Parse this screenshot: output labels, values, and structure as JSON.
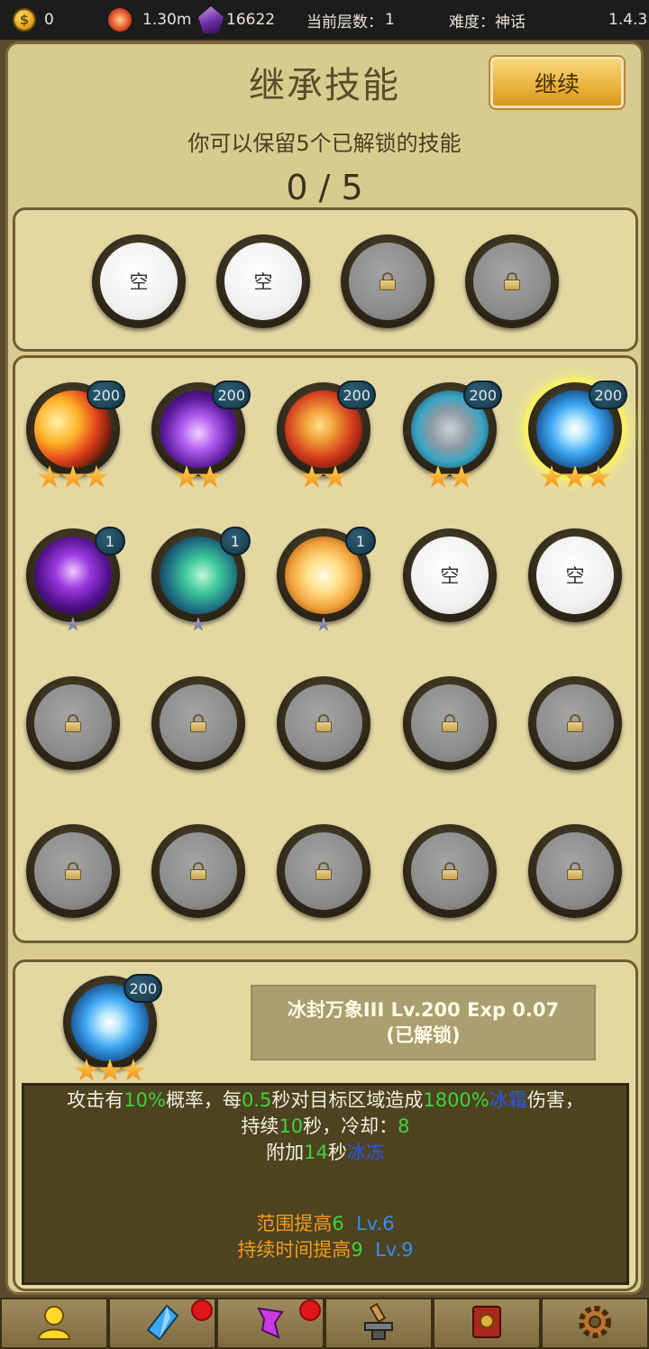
{
  "topbar": {
    "gold": "0",
    "power": "1.30m",
    "gems": "16622",
    "floor_label": "当前层数：",
    "floor_value": "1",
    "difficulty_label": "难度：",
    "difficulty_value": "神话",
    "version": "1.4.3"
  },
  "header": {
    "title": "继承技能",
    "subtitle": "你可以保留5个已解锁的技能",
    "counter": "0 / 5",
    "continue_label": "继续"
  },
  "selected_slots": [
    {
      "state": "empty",
      "label": "空"
    },
    {
      "state": "empty",
      "label": "空"
    },
    {
      "state": "locked"
    },
    {
      "state": "locked"
    }
  ],
  "skills": [
    {
      "icon": "fire-blast-icon",
      "level": "200",
      "stars": 3,
      "state": "unlocked"
    },
    {
      "icon": "void-orb-icon",
      "level": "200",
      "stars": 2,
      "state": "unlocked"
    },
    {
      "icon": "fire-beast-icon",
      "level": "200",
      "stars": 2,
      "state": "unlocked"
    },
    {
      "icon": "rock-shield-icon",
      "level": "200",
      "stars": 2,
      "state": "unlocked"
    },
    {
      "icon": "ice-crystal-icon",
      "level": "200",
      "stars": 3,
      "state": "unlocked",
      "selected": true
    },
    {
      "icon": "purple-lightning-icon",
      "level": "1",
      "stars": 1,
      "state": "unlocked"
    },
    {
      "icon": "green-wind-icon",
      "level": "1",
      "stars": 1,
      "state": "unlocked"
    },
    {
      "icon": "sun-burst-icon",
      "level": "1",
      "stars": 1,
      "state": "unlocked"
    },
    {
      "state": "empty",
      "label": "空"
    },
    {
      "state": "empty",
      "label": "空"
    },
    {
      "state": "locked"
    },
    {
      "state": "locked"
    },
    {
      "state": "locked"
    },
    {
      "state": "locked"
    },
    {
      "state": "locked"
    },
    {
      "state": "locked"
    },
    {
      "state": "locked"
    },
    {
      "state": "locked"
    },
    {
      "state": "locked"
    },
    {
      "state": "locked"
    }
  ],
  "detail": {
    "icon": "ice-crystal-icon",
    "level": "200",
    "stars": 3,
    "name_line1": "冰封万象III Lv.200  Exp 0.07",
    "name_line2": "(已解锁)",
    "desc": {
      "p1": "攻击有",
      "v1": "10%",
      "p2": "概率，每",
      "v2": "0.5",
      "p3": "秒对目标区域造成",
      "v3": "1800%",
      "e1": "冰霜",
      "p4": "伤害，",
      "p5": "持续",
      "v4": "10",
      "p6": "秒，冷却：",
      "v5": "8",
      "p7": "附加",
      "v6": "14",
      "p8": "秒",
      "e2": "冰冻",
      "u1a": "范围提高",
      "u1b": "6",
      "u1c": "Lv.6",
      "u2a": "持续时间提高",
      "u2b": "9",
      "u2c": "Lv.9"
    }
  },
  "nav": [
    {
      "icon": "hero-icon",
      "dot": false
    },
    {
      "icon": "blue-crystal-icon",
      "dot": true
    },
    {
      "icon": "purple-crystal-icon",
      "dot": true
    },
    {
      "icon": "forge-anvil-icon",
      "dot": false
    },
    {
      "icon": "spellbook-icon",
      "dot": false
    },
    {
      "icon": "settings-gear-icon",
      "dot": false
    }
  ],
  "colors": {
    "parchment": "#d8cb8e",
    "value_green": "#3fd339",
    "element_blue": "#2c55f0",
    "upgrade_orange": "#f19a1d",
    "level_blue": "#3a8bee"
  }
}
